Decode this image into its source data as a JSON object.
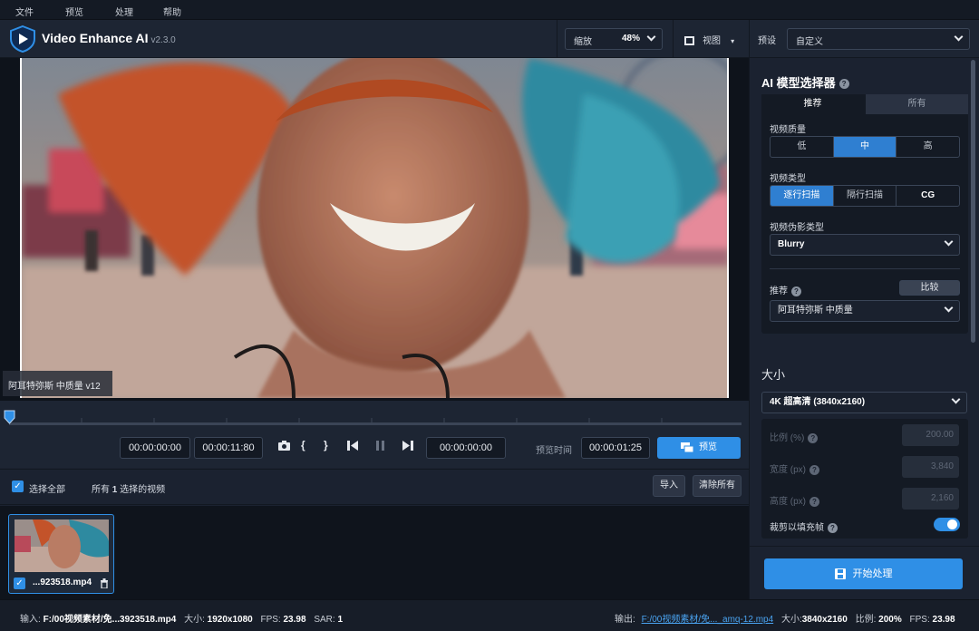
{
  "menu": [
    "文件",
    "预览",
    "处理",
    "帮助"
  ],
  "app": {
    "name": "Video Enhance AI",
    "version": "v2.3.0"
  },
  "zoom": {
    "label": "缩放",
    "value": "48%"
  },
  "view": {
    "label": "视图"
  },
  "preset": {
    "label": "预设",
    "value": "自定义"
  },
  "video": {
    "overlay_label": "阿耳特弥斯 中质量 v12"
  },
  "timeline": {
    "start_time": "00:00:00:00",
    "end_time": "00:00:11:80",
    "current_time": "00:00:00:00",
    "preview_time_label": "预览时间",
    "preview_time": "00:00:01:25",
    "preview_button": "预览"
  },
  "list": {
    "select_all": "选择全部",
    "summary_prefix": "所有",
    "summary_count": "1",
    "summary_suffix": "选择的视频",
    "import": "导入",
    "clear_all": "清除所有"
  },
  "file": {
    "name": "...923518.mp4"
  },
  "sidebar": {
    "ai_title": "AI 模型选择器",
    "tabs": [
      "推荐",
      "所有"
    ],
    "quality_label": "视频质量",
    "quality_options": [
      "低",
      "中",
      "高"
    ],
    "type_label": "视频类型",
    "type_options": [
      "逐行扫描",
      "隔行扫描",
      "CG"
    ],
    "artifact_label": "视频伪影类型",
    "artifact_value": "Blurry",
    "recommend_label": "推荐",
    "compare": "比较",
    "model_value": "阿耳特弥斯 中质量",
    "size_title": "大小",
    "size_value": "4K 超高清 (3840x2160)",
    "ratio_label": "比例 (%)",
    "ratio_value": "200.00",
    "width_label": "宽度 (px)",
    "width_value": "3,840",
    "height_label": "高度 (px)",
    "height_value": "2,160",
    "crop_label": "裁剪以填充帧",
    "start_button": "开始处理"
  },
  "status": {
    "input_label": "输入:",
    "input_path": "F:/00视频素材/免...3923518.mp4",
    "in_size_label": "大小:",
    "in_size": "1920x1080",
    "in_fps_label": "FPS:",
    "in_fps": "23.98",
    "sar_label": "SAR:",
    "sar": "1",
    "output_label": "输出:",
    "output_path": "F:/00视频素材/免..._amq-12.mp4",
    "out_size_label": "大小:",
    "out_size": "3840x2160",
    "ratio_label": "比例:",
    "ratio": "200%",
    "out_fps_label": "FPS:",
    "out_fps": "23.98"
  },
  "colors": {
    "accent": "#2f8fe6",
    "panel": "#1b2230",
    "menubar": "#141a24"
  }
}
